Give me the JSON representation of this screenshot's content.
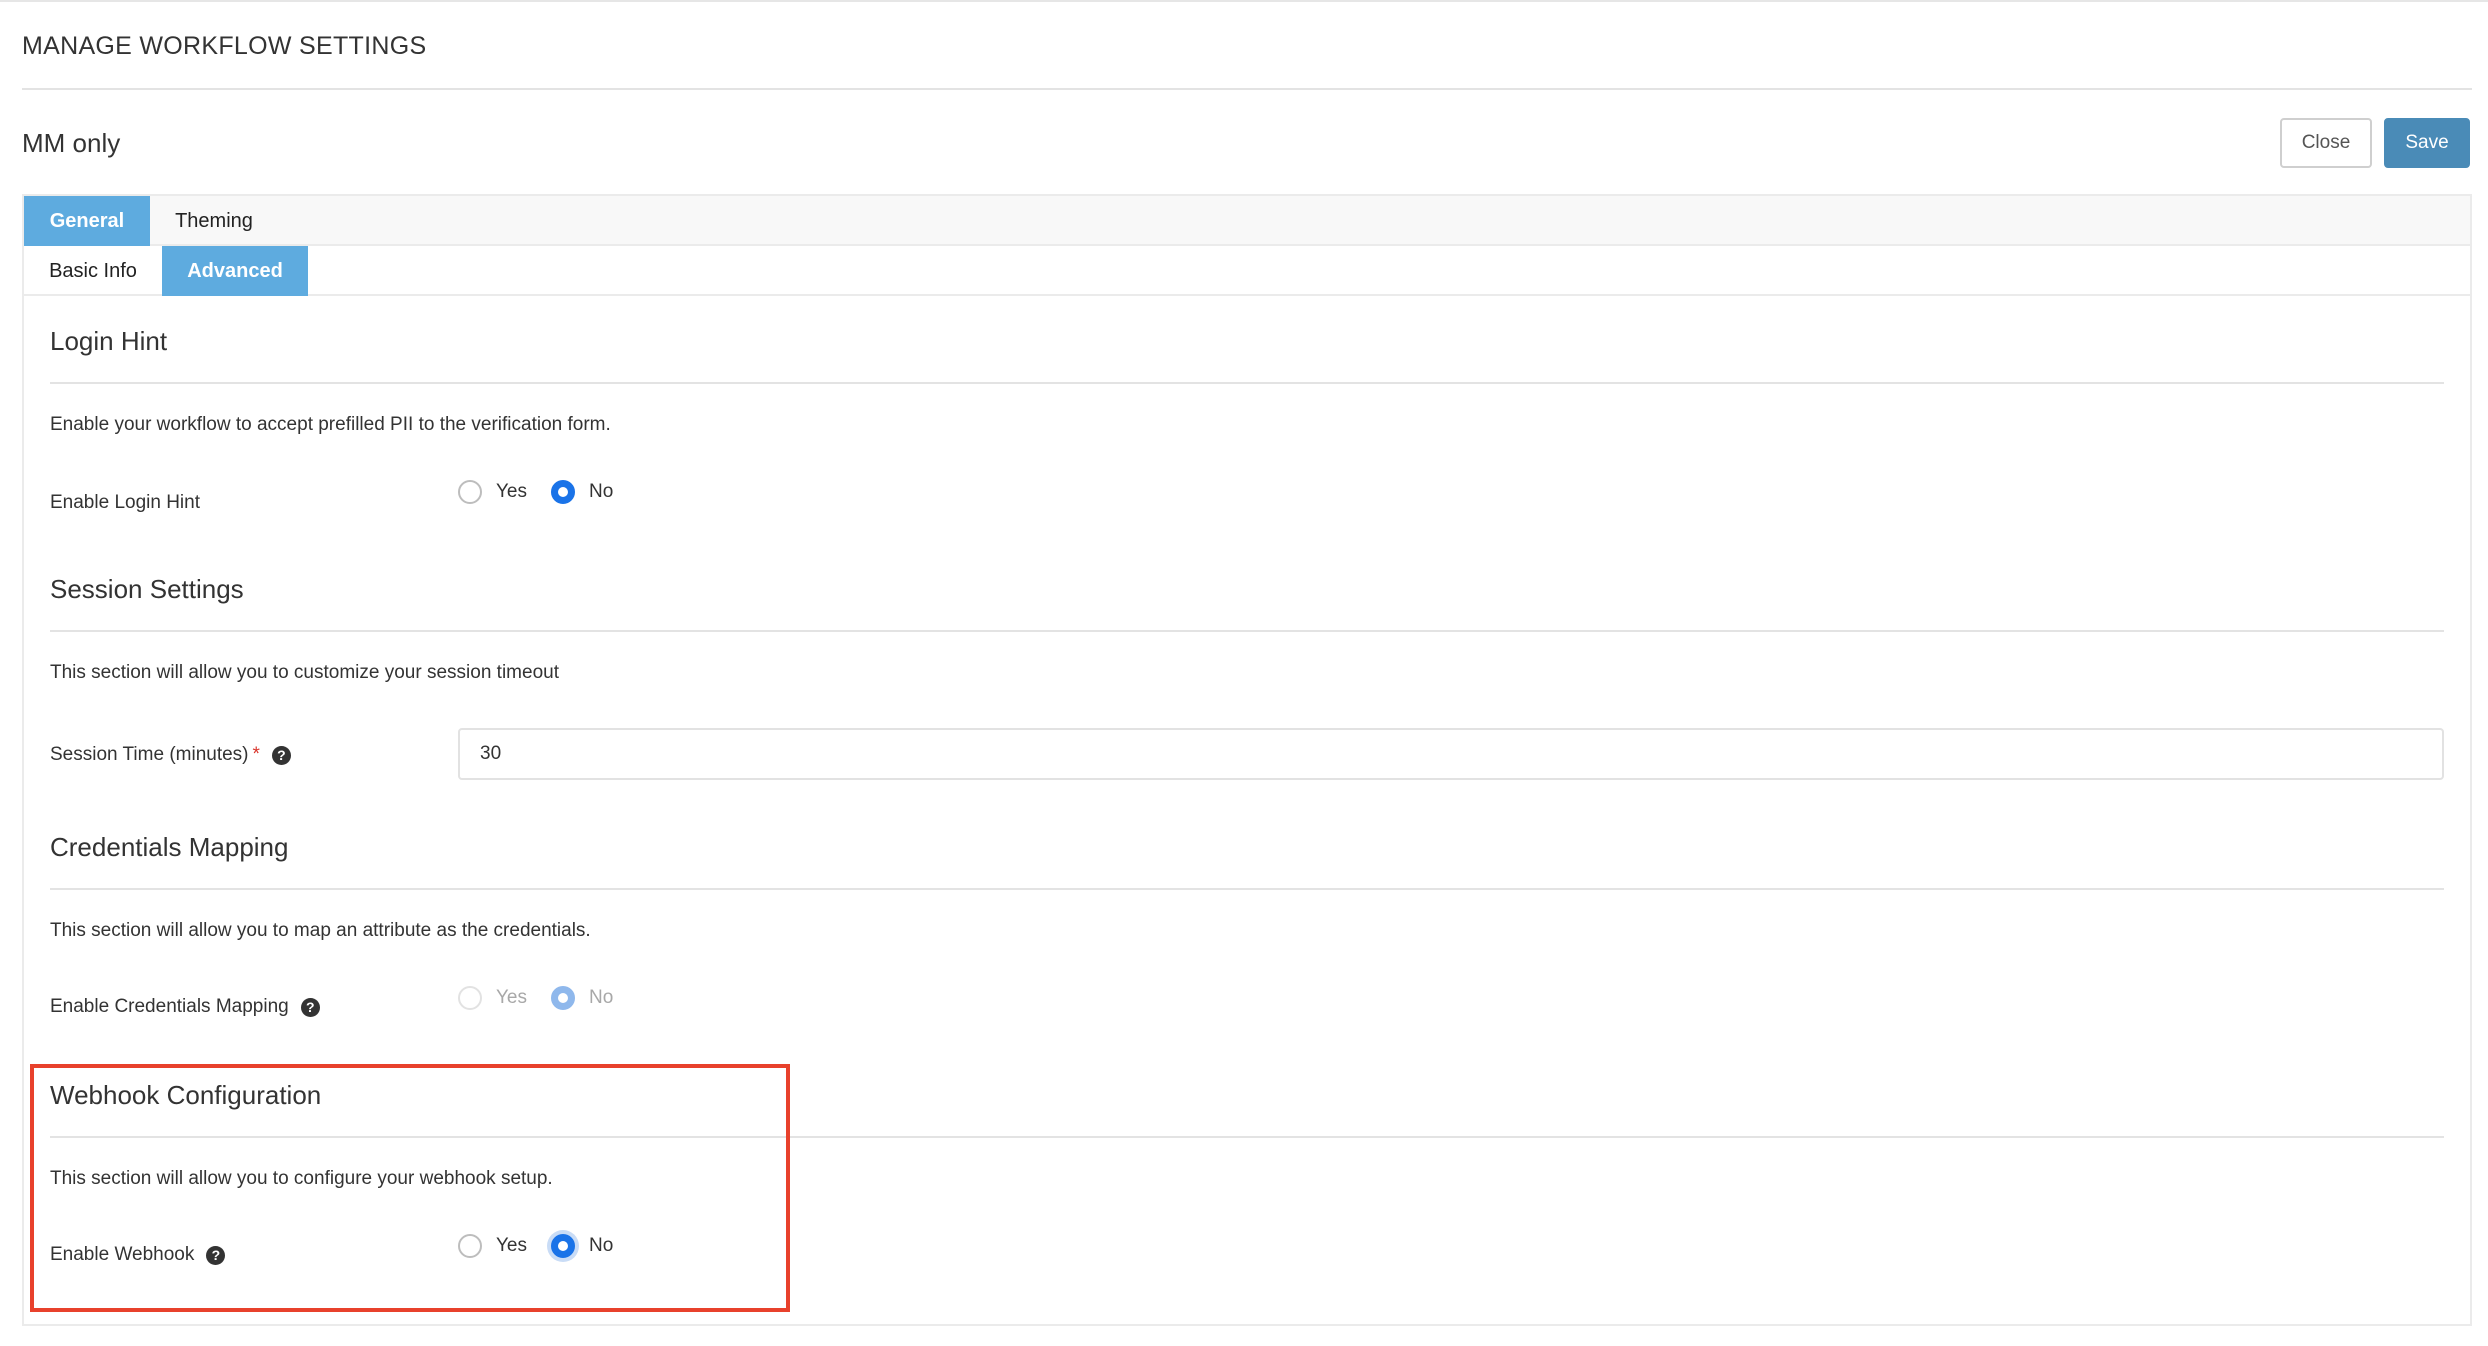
{
  "page": {
    "heading": "MANAGE WORKFLOW SETTINGS",
    "workflow_name": "MM only"
  },
  "toolbar": {
    "close_label": "Close",
    "save_label": "Save"
  },
  "tabs": {
    "primary": [
      {
        "label": "General",
        "active": true
      },
      {
        "label": "Theming",
        "active": false
      }
    ],
    "secondary": [
      {
        "label": "Basic Info",
        "active": false
      },
      {
        "label": "Advanced",
        "active": true
      }
    ]
  },
  "sections": {
    "login_hint": {
      "title": "Login Hint",
      "description": "Enable your workflow to accept prefilled PII to the verification form.",
      "field_label": "Enable Login Hint",
      "options": [
        "Yes",
        "No"
      ],
      "selected": "No"
    },
    "session": {
      "title": "Session Settings",
      "description": "This section will allow you to customize your session timeout",
      "field_label": "Session Time (minutes)",
      "required_mark": "*",
      "value": "30"
    },
    "credentials": {
      "title": "Credentials Mapping",
      "description": "This section will allow you to map an attribute as the credentials.",
      "field_label": "Enable Credentials Mapping",
      "options": [
        "Yes",
        "No"
      ],
      "selected": "No",
      "disabled": true
    },
    "webhook": {
      "title": "Webhook Configuration",
      "description": "This section will allow you to configure your webhook setup.",
      "field_label": "Enable Webhook",
      "options": [
        "Yes",
        "No"
      ],
      "selected": "No",
      "highlighted": true
    }
  },
  "icons": {
    "help": "question-circle-icon"
  },
  "colors": {
    "accent_tab": "#5eabdf",
    "save_button": "#4a8bb7",
    "radio_checked": "#1a73e8",
    "highlight": "#e8412c",
    "required": "#d9342b"
  }
}
